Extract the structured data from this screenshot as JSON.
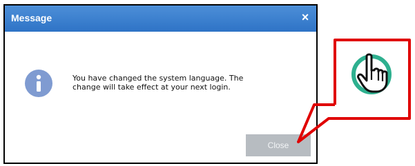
{
  "dialog": {
    "title": "Message",
    "close_glyph": "×",
    "icon": "info-icon",
    "message_line1": "You have changed the system language. The",
    "message_line2": "change will take effect at your next login.",
    "button_label": "Close"
  },
  "callout": {
    "icon": "tap-hand-icon",
    "border_color": "#e00000",
    "accent_color": "#2eb08f"
  },
  "colors": {
    "titlebar": "#2e73c6",
    "info_icon": "#7f9bd1",
    "button_bg": "#b7bcc1"
  }
}
